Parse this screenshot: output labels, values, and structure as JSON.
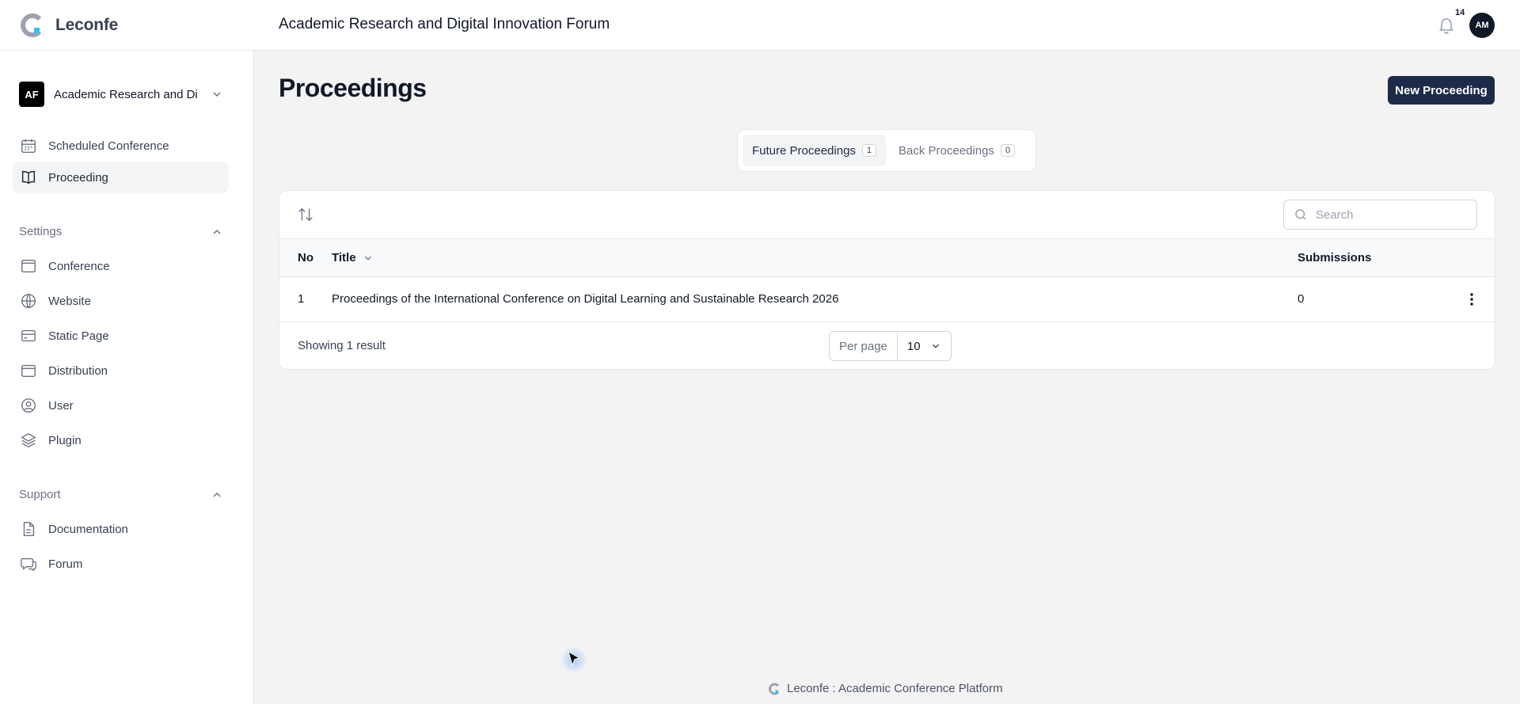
{
  "app": {
    "brand": "Leconfe"
  },
  "header": {
    "conference_title": "Academic Research and Digital Innovation Forum",
    "notification_count": "14",
    "avatar_initials": "AM"
  },
  "sidebar": {
    "conference_switcher": {
      "initials": "AF",
      "label": "Academic Research and Digital Innovation Forum"
    },
    "items": [
      {
        "label": "Scheduled Conference",
        "icon": "calendar-icon"
      },
      {
        "label": "Proceeding",
        "icon": "book-open-icon",
        "active": true
      }
    ],
    "settings": {
      "heading": "Settings",
      "items": [
        {
          "label": "Conference",
          "icon": "window-icon"
        },
        {
          "label": "Website",
          "icon": "globe-icon"
        },
        {
          "label": "Static Page",
          "icon": "credit-card-icon"
        },
        {
          "label": "Distribution",
          "icon": "calendar-blank-icon"
        },
        {
          "label": "User",
          "icon": "user-circle-icon"
        },
        {
          "label": "Plugin",
          "icon": "stack-icon"
        }
      ]
    },
    "support": {
      "heading": "Support",
      "items": [
        {
          "label": "Documentation",
          "icon": "document-icon"
        },
        {
          "label": "Forum",
          "icon": "chat-icon"
        }
      ]
    }
  },
  "main": {
    "title": "Proceedings",
    "new_button": "New Proceeding",
    "tabs": [
      {
        "label": "Future Proceedings",
        "count": "1",
        "active": true
      },
      {
        "label": "Back Proceedings",
        "count": "0",
        "active": false
      }
    ],
    "table": {
      "search_placeholder": "Search",
      "columns": {
        "no": "No",
        "title": "Title",
        "submissions": "Submissions"
      },
      "rows": [
        {
          "no": "1",
          "title": "Proceedings of the International Conference on Digital Learning and Sustainable Research 2026",
          "submissions": "0"
        }
      ],
      "result_text": "Showing 1 result",
      "per_page_label": "Per page",
      "per_page_value": "10"
    }
  },
  "footer": {
    "text": "Leconfe : Academic Conference Platform"
  },
  "colors": {
    "primary_button": "#1e2a4a",
    "logo_accent": "#38bdf8"
  }
}
